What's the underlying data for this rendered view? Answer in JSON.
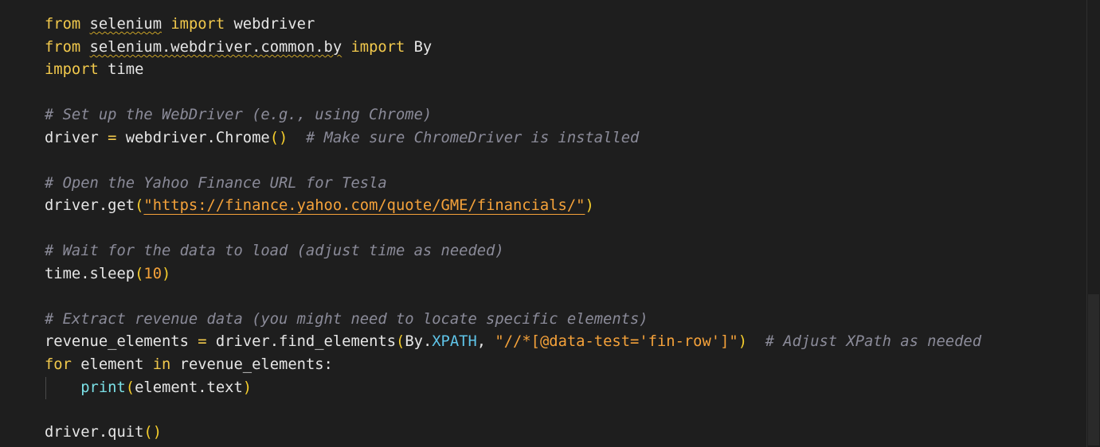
{
  "editor": {
    "language": "python",
    "lines": {
      "l1": {
        "kw1": "from",
        "mod": "selenium",
        "kw2": "import",
        "name": "webdriver"
      },
      "l2": {
        "kw1": "from",
        "mod": "selenium.webdriver.common.by",
        "kw2": "import",
        "name": "By"
      },
      "l3": {
        "kw1": "import",
        "name": "time"
      },
      "l5": {
        "comment": "# Set up the WebDriver (e.g., using Chrome)"
      },
      "l6": {
        "var": "driver",
        "op": "=",
        "call": "webdriver.Chrome",
        "parens": "()",
        "comment": "# Make sure ChromeDriver is installed"
      },
      "l8": {
        "comment": "# Open the Yahoo Finance URL for Tesla"
      },
      "l9": {
        "call": "driver.get",
        "open": "(",
        "url": "\"https://finance.yahoo.com/quote/GME/financials/\"",
        "close": ")"
      },
      "l11": {
        "comment": "# Wait for the data to load (adjust time as needed)"
      },
      "l12": {
        "call": "time.sleep",
        "open": "(",
        "num": "10",
        "close": ")"
      },
      "l14": {
        "comment": "# Extract revenue data (you might need to locate specific elements)"
      },
      "l15": {
        "var": "revenue_elements",
        "op": "=",
        "call": "driver.find_elements",
        "open": "(",
        "arg1": "By.",
        "const": "XPATH",
        "sep": ", ",
        "str": "\"//*[@data-test='fin-row']\"",
        "close": ")",
        "comment": "# Adjust XPath as needed"
      },
      "l16": {
        "kw1": "for",
        "var": "element",
        "kw2": "in",
        "iter": "revenue_elements:"
      },
      "l17": {
        "fn": "print",
        "open": "(",
        "arg": "element.text",
        "close": ")"
      },
      "l19": {
        "call": "driver.quit",
        "parens": "()"
      }
    }
  },
  "colors": {
    "background": "#1e1e1e",
    "keyword": "#f2c94c",
    "comment": "#8b8b99",
    "string": "#f5a23a",
    "builtin": "#7be0e6",
    "constant": "#5fc4e8",
    "text": "#e6e6e6"
  }
}
